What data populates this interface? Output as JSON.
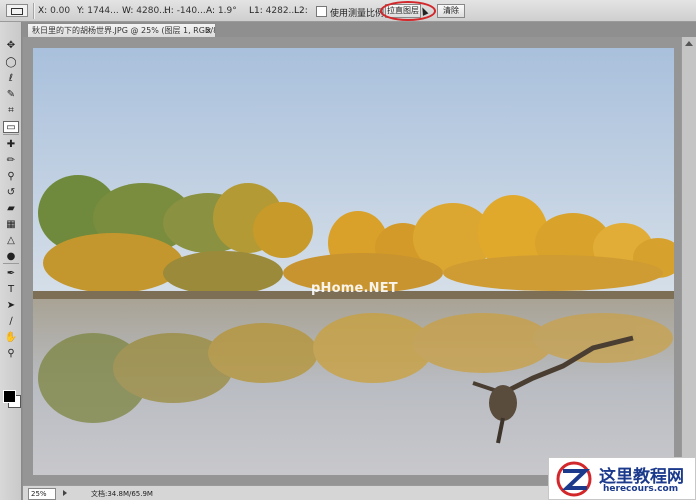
{
  "options_bar": {
    "x_label": "X:",
    "x_value": "0.00",
    "y_label": "Y:",
    "y_value": "1744...",
    "w_label": "W:",
    "w_value": "4280...",
    "h_label": "H:",
    "h_value": "-140...",
    "a_label": "A:",
    "a_value": "1.9°",
    "l1_label": "L1:",
    "l1_value": "4282...",
    "l2_label": "L2:",
    "l2_value": "",
    "measure_scale_label": "使用测量比例",
    "straighten_button": "拉直图层",
    "clear_button": "清除"
  },
  "document_tab": {
    "title": "秋日里的下的胡杨世界.JPG @ 25% (图层 1, RGB/8*) *",
    "close": "×"
  },
  "tools": [
    {
      "name": "move-tool-icon",
      "glyph": "✥"
    },
    {
      "name": "ellipse-marquee-icon",
      "glyph": "◯"
    },
    {
      "name": "lasso-icon",
      "glyph": "ℓ"
    },
    {
      "name": "quick-select-icon",
      "glyph": "✎"
    },
    {
      "name": "crop-icon",
      "glyph": "⌗"
    },
    {
      "name": "ruler-icon",
      "glyph": "▭"
    },
    {
      "name": "healing-brush-icon",
      "glyph": "✚"
    },
    {
      "name": "brush-icon",
      "glyph": "✏"
    },
    {
      "name": "clone-stamp-icon",
      "glyph": "⚲"
    },
    {
      "name": "history-brush-icon",
      "glyph": "↺"
    },
    {
      "name": "eraser-icon",
      "glyph": "▰"
    },
    {
      "name": "gradient-icon",
      "glyph": "▦"
    },
    {
      "name": "blur-icon",
      "glyph": "△"
    },
    {
      "name": "dodge-icon",
      "glyph": "●"
    },
    {
      "name": "pen-icon",
      "glyph": "✒"
    },
    {
      "name": "type-icon",
      "glyph": "T"
    },
    {
      "name": "path-select-icon",
      "glyph": "➤"
    },
    {
      "name": "line-icon",
      "glyph": "∕"
    },
    {
      "name": "hand-icon",
      "glyph": "✋"
    },
    {
      "name": "zoom-icon",
      "glyph": "⚲"
    }
  ],
  "status": {
    "zoom": "25%",
    "doc_info": "文档:34.8M/65.9M"
  },
  "photo": {
    "watermark": "pHome.NET"
  },
  "logo": {
    "title": "这里教程网",
    "url": "herecours.com"
  }
}
